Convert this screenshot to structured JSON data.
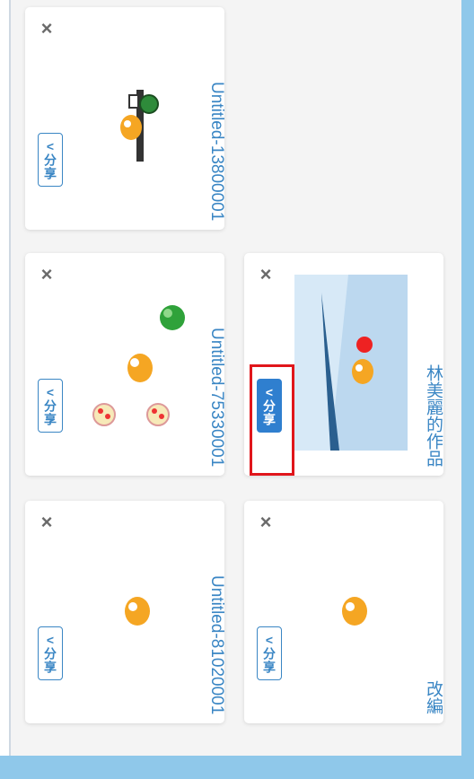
{
  "cards": [
    {
      "title": "Untitled-13800001",
      "share_label": "分享",
      "close_label": "×"
    },
    {
      "title": "Untitled-75330001",
      "share_label": "分享",
      "close_label": "×"
    },
    {
      "title": "Untitled-81020001",
      "share_label": "分享",
      "close_label": "×"
    },
    {
      "title": "林美麗的作品",
      "share_label": "分享",
      "close_label": "×"
    },
    {
      "title": "改編",
      "share_label": "分享",
      "close_label": "×"
    }
  ],
  "share_icon": "share-icon",
  "colors": {
    "accent": "#3a86c4",
    "share_filled": "#2f7fcf",
    "highlight": "#e0161b",
    "frame": "#8fc8ea"
  }
}
